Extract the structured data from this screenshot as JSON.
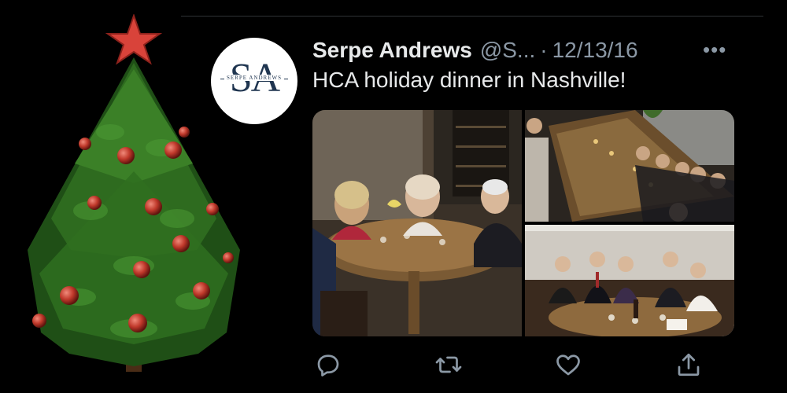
{
  "avatar": {
    "monogram": "SA",
    "subtitle": "SERPE ANDREWS"
  },
  "tweet": {
    "author_name": "Serpe Andrews",
    "handle": "@S...",
    "separator": "·",
    "date": "12/13/16",
    "more_label": "•••",
    "text": "HCA holiday dinner in Nashville!"
  },
  "media": {
    "photo_count": 3
  },
  "icons": {
    "decoration": "christmas-tree-icon",
    "reply": "reply-icon",
    "retweet": "retweet-icon",
    "like": "like-icon",
    "share": "share-icon"
  },
  "colors": {
    "background": "#000000",
    "text": "#e7e9ea",
    "muted": "#8b98a5",
    "brand_navy": "#1f3550",
    "ornament": "#c0392b",
    "tree_green": "#2e6b1f"
  }
}
